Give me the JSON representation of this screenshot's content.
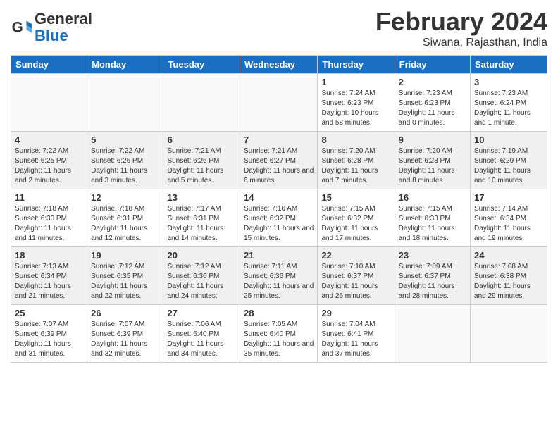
{
  "header": {
    "logo_text_general": "General",
    "logo_text_blue": "Blue",
    "month_year": "February 2024",
    "location": "Siwana, Rajasthan, India"
  },
  "days_of_week": [
    "Sunday",
    "Monday",
    "Tuesday",
    "Wednesday",
    "Thursday",
    "Friday",
    "Saturday"
  ],
  "weeks": [
    [
      {
        "day": "",
        "info": ""
      },
      {
        "day": "",
        "info": ""
      },
      {
        "day": "",
        "info": ""
      },
      {
        "day": "",
        "info": ""
      },
      {
        "day": "1",
        "info": "Sunrise: 7:24 AM\nSunset: 6:23 PM\nDaylight: 10 hours and 58 minutes."
      },
      {
        "day": "2",
        "info": "Sunrise: 7:23 AM\nSunset: 6:23 PM\nDaylight: 11 hours and 0 minutes."
      },
      {
        "day": "3",
        "info": "Sunrise: 7:23 AM\nSunset: 6:24 PM\nDaylight: 11 hours and 1 minute."
      }
    ],
    [
      {
        "day": "4",
        "info": "Sunrise: 7:22 AM\nSunset: 6:25 PM\nDaylight: 11 hours and 2 minutes."
      },
      {
        "day": "5",
        "info": "Sunrise: 7:22 AM\nSunset: 6:26 PM\nDaylight: 11 hours and 3 minutes."
      },
      {
        "day": "6",
        "info": "Sunrise: 7:21 AM\nSunset: 6:26 PM\nDaylight: 11 hours and 5 minutes."
      },
      {
        "day": "7",
        "info": "Sunrise: 7:21 AM\nSunset: 6:27 PM\nDaylight: 11 hours and 6 minutes."
      },
      {
        "day": "8",
        "info": "Sunrise: 7:20 AM\nSunset: 6:28 PM\nDaylight: 11 hours and 7 minutes."
      },
      {
        "day": "9",
        "info": "Sunrise: 7:20 AM\nSunset: 6:28 PM\nDaylight: 11 hours and 8 minutes."
      },
      {
        "day": "10",
        "info": "Sunrise: 7:19 AM\nSunset: 6:29 PM\nDaylight: 11 hours and 10 minutes."
      }
    ],
    [
      {
        "day": "11",
        "info": "Sunrise: 7:18 AM\nSunset: 6:30 PM\nDaylight: 11 hours and 11 minutes."
      },
      {
        "day": "12",
        "info": "Sunrise: 7:18 AM\nSunset: 6:31 PM\nDaylight: 11 hours and 12 minutes."
      },
      {
        "day": "13",
        "info": "Sunrise: 7:17 AM\nSunset: 6:31 PM\nDaylight: 11 hours and 14 minutes."
      },
      {
        "day": "14",
        "info": "Sunrise: 7:16 AM\nSunset: 6:32 PM\nDaylight: 11 hours and 15 minutes."
      },
      {
        "day": "15",
        "info": "Sunrise: 7:15 AM\nSunset: 6:32 PM\nDaylight: 11 hours and 17 minutes."
      },
      {
        "day": "16",
        "info": "Sunrise: 7:15 AM\nSunset: 6:33 PM\nDaylight: 11 hours and 18 minutes."
      },
      {
        "day": "17",
        "info": "Sunrise: 7:14 AM\nSunset: 6:34 PM\nDaylight: 11 hours and 19 minutes."
      }
    ],
    [
      {
        "day": "18",
        "info": "Sunrise: 7:13 AM\nSunset: 6:34 PM\nDaylight: 11 hours and 21 minutes."
      },
      {
        "day": "19",
        "info": "Sunrise: 7:12 AM\nSunset: 6:35 PM\nDaylight: 11 hours and 22 minutes."
      },
      {
        "day": "20",
        "info": "Sunrise: 7:12 AM\nSunset: 6:36 PM\nDaylight: 11 hours and 24 minutes."
      },
      {
        "day": "21",
        "info": "Sunrise: 7:11 AM\nSunset: 6:36 PM\nDaylight: 11 hours and 25 minutes."
      },
      {
        "day": "22",
        "info": "Sunrise: 7:10 AM\nSunset: 6:37 PM\nDaylight: 11 hours and 26 minutes."
      },
      {
        "day": "23",
        "info": "Sunrise: 7:09 AM\nSunset: 6:37 PM\nDaylight: 11 hours and 28 minutes."
      },
      {
        "day": "24",
        "info": "Sunrise: 7:08 AM\nSunset: 6:38 PM\nDaylight: 11 hours and 29 minutes."
      }
    ],
    [
      {
        "day": "25",
        "info": "Sunrise: 7:07 AM\nSunset: 6:39 PM\nDaylight: 11 hours and 31 minutes."
      },
      {
        "day": "26",
        "info": "Sunrise: 7:07 AM\nSunset: 6:39 PM\nDaylight: 11 hours and 32 minutes."
      },
      {
        "day": "27",
        "info": "Sunrise: 7:06 AM\nSunset: 6:40 PM\nDaylight: 11 hours and 34 minutes."
      },
      {
        "day": "28",
        "info": "Sunrise: 7:05 AM\nSunset: 6:40 PM\nDaylight: 11 hours and 35 minutes."
      },
      {
        "day": "29",
        "info": "Sunrise: 7:04 AM\nSunset: 6:41 PM\nDaylight: 11 hours and 37 minutes."
      },
      {
        "day": "",
        "info": ""
      },
      {
        "day": "",
        "info": ""
      }
    ]
  ]
}
